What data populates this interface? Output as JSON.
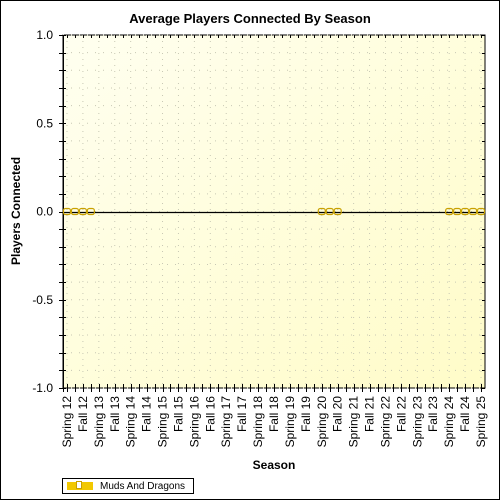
{
  "chart_data": {
    "type": "line",
    "title": "Average Players Connected By Season",
    "xlabel": "Season",
    "ylabel": "Players Connected",
    "ylim": [
      -1.0,
      1.0
    ],
    "yticks": [
      "1.0",
      "0.5",
      "0.0",
      "-0.5",
      "-1.0"
    ],
    "ytick_values": [
      1.0,
      0.5,
      0.0,
      -0.5,
      -1.0
    ],
    "categories": [
      "Spring 12",
      "Fall 12",
      "Spring 13",
      "Fall 13",
      "Spring 14",
      "Fall 14",
      "Spring 15",
      "Fall 15",
      "Spring 16",
      "Fall 16",
      "Spring 17",
      "Fall 17",
      "Spring 18",
      "Fall 18",
      "Spring 19",
      "Fall 19",
      "Spring 20",
      "Fall 20",
      "Spring 21",
      "Fall 21",
      "Spring 22",
      "Fall 22",
      "Spring 23",
      "Fall 23",
      "Spring 24",
      "Fall 24",
      "Spring 25"
    ],
    "x_slots": 53,
    "grid": true,
    "legend_position": "bottom-left",
    "series": [
      {
        "name": "Muds And Dragons",
        "color": "#c8a000",
        "points": [
          {
            "slot": 0,
            "value": 0
          },
          {
            "slot": 1,
            "value": 0
          },
          {
            "slot": 2,
            "value": 0
          },
          {
            "slot": 3,
            "value": 0
          },
          {
            "slot": 32,
            "value": 0
          },
          {
            "slot": 33,
            "value": 0
          },
          {
            "slot": 34,
            "value": 0
          },
          {
            "slot": 48,
            "value": 0
          },
          {
            "slot": 49,
            "value": 0
          },
          {
            "slot": 50,
            "value": 0
          },
          {
            "slot": 51,
            "value": 0
          },
          {
            "slot": 52,
            "value": 0
          }
        ]
      }
    ]
  },
  "legend": {
    "label": "Muds And Dragons"
  }
}
